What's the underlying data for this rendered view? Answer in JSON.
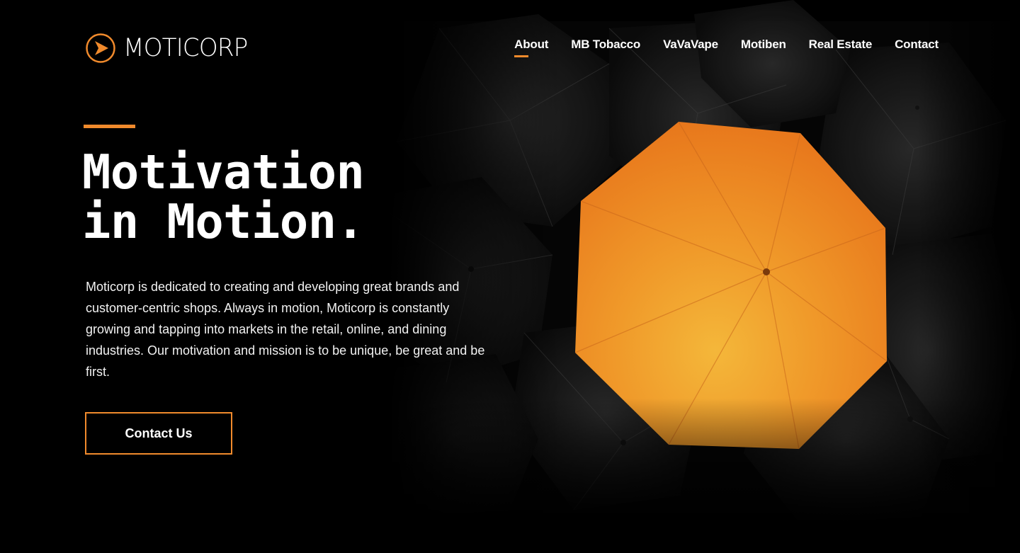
{
  "brand": {
    "name": "MOTICORP",
    "logo_icon": "chevron-arrow-circle-icon",
    "accent_color": "#f08a2c"
  },
  "nav": {
    "items": [
      {
        "label": "About",
        "active": true
      },
      {
        "label": "MB Tobacco",
        "active": false
      },
      {
        "label": "VaVaVape",
        "active": false
      },
      {
        "label": "Motiben",
        "active": false
      },
      {
        "label": "Real Estate",
        "active": false
      },
      {
        "label": "Contact",
        "active": false
      }
    ]
  },
  "hero": {
    "headline_line1": "Motivation",
    "headline_line2": "in Motion.",
    "description": "Moticorp is dedicated to creating and developing great brands and customer-centric shops. Always in motion, Moticorp is constantly growing and tapping into markets in the retail, online, and dining industries. Our motivation and mission is to be unique, be great and be first.",
    "cta_label": "Contact Us",
    "background_image": "orange-umbrella-among-black-umbrellas"
  }
}
